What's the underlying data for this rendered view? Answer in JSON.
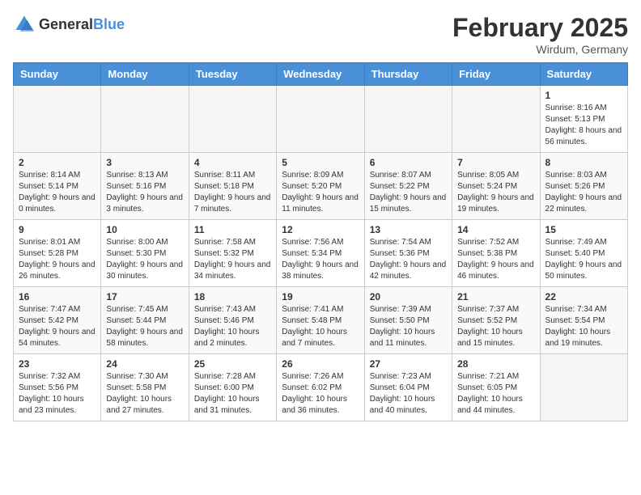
{
  "logo": {
    "general": "General",
    "blue": "Blue"
  },
  "header": {
    "month_year": "February 2025",
    "location": "Wirdum, Germany"
  },
  "weekdays": [
    "Sunday",
    "Monday",
    "Tuesday",
    "Wednesday",
    "Thursday",
    "Friday",
    "Saturday"
  ],
  "weeks": [
    [
      {
        "day": "",
        "detail": ""
      },
      {
        "day": "",
        "detail": ""
      },
      {
        "day": "",
        "detail": ""
      },
      {
        "day": "",
        "detail": ""
      },
      {
        "day": "",
        "detail": ""
      },
      {
        "day": "",
        "detail": ""
      },
      {
        "day": "1",
        "detail": "Sunrise: 8:16 AM\nSunset: 5:13 PM\nDaylight: 8 hours and 56 minutes."
      }
    ],
    [
      {
        "day": "2",
        "detail": "Sunrise: 8:14 AM\nSunset: 5:14 PM\nDaylight: 9 hours and 0 minutes."
      },
      {
        "day": "3",
        "detail": "Sunrise: 8:13 AM\nSunset: 5:16 PM\nDaylight: 9 hours and 3 minutes."
      },
      {
        "day": "4",
        "detail": "Sunrise: 8:11 AM\nSunset: 5:18 PM\nDaylight: 9 hours and 7 minutes."
      },
      {
        "day": "5",
        "detail": "Sunrise: 8:09 AM\nSunset: 5:20 PM\nDaylight: 9 hours and 11 minutes."
      },
      {
        "day": "6",
        "detail": "Sunrise: 8:07 AM\nSunset: 5:22 PM\nDaylight: 9 hours and 15 minutes."
      },
      {
        "day": "7",
        "detail": "Sunrise: 8:05 AM\nSunset: 5:24 PM\nDaylight: 9 hours and 19 minutes."
      },
      {
        "day": "8",
        "detail": "Sunrise: 8:03 AM\nSunset: 5:26 PM\nDaylight: 9 hours and 22 minutes."
      }
    ],
    [
      {
        "day": "9",
        "detail": "Sunrise: 8:01 AM\nSunset: 5:28 PM\nDaylight: 9 hours and 26 minutes."
      },
      {
        "day": "10",
        "detail": "Sunrise: 8:00 AM\nSunset: 5:30 PM\nDaylight: 9 hours and 30 minutes."
      },
      {
        "day": "11",
        "detail": "Sunrise: 7:58 AM\nSunset: 5:32 PM\nDaylight: 9 hours and 34 minutes."
      },
      {
        "day": "12",
        "detail": "Sunrise: 7:56 AM\nSunset: 5:34 PM\nDaylight: 9 hours and 38 minutes."
      },
      {
        "day": "13",
        "detail": "Sunrise: 7:54 AM\nSunset: 5:36 PM\nDaylight: 9 hours and 42 minutes."
      },
      {
        "day": "14",
        "detail": "Sunrise: 7:52 AM\nSunset: 5:38 PM\nDaylight: 9 hours and 46 minutes."
      },
      {
        "day": "15",
        "detail": "Sunrise: 7:49 AM\nSunset: 5:40 PM\nDaylight: 9 hours and 50 minutes."
      }
    ],
    [
      {
        "day": "16",
        "detail": "Sunrise: 7:47 AM\nSunset: 5:42 PM\nDaylight: 9 hours and 54 minutes."
      },
      {
        "day": "17",
        "detail": "Sunrise: 7:45 AM\nSunset: 5:44 PM\nDaylight: 9 hours and 58 minutes."
      },
      {
        "day": "18",
        "detail": "Sunrise: 7:43 AM\nSunset: 5:46 PM\nDaylight: 10 hours and 2 minutes."
      },
      {
        "day": "19",
        "detail": "Sunrise: 7:41 AM\nSunset: 5:48 PM\nDaylight: 10 hours and 7 minutes."
      },
      {
        "day": "20",
        "detail": "Sunrise: 7:39 AM\nSunset: 5:50 PM\nDaylight: 10 hours and 11 minutes."
      },
      {
        "day": "21",
        "detail": "Sunrise: 7:37 AM\nSunset: 5:52 PM\nDaylight: 10 hours and 15 minutes."
      },
      {
        "day": "22",
        "detail": "Sunrise: 7:34 AM\nSunset: 5:54 PM\nDaylight: 10 hours and 19 minutes."
      }
    ],
    [
      {
        "day": "23",
        "detail": "Sunrise: 7:32 AM\nSunset: 5:56 PM\nDaylight: 10 hours and 23 minutes."
      },
      {
        "day": "24",
        "detail": "Sunrise: 7:30 AM\nSunset: 5:58 PM\nDaylight: 10 hours and 27 minutes."
      },
      {
        "day": "25",
        "detail": "Sunrise: 7:28 AM\nSunset: 6:00 PM\nDaylight: 10 hours and 31 minutes."
      },
      {
        "day": "26",
        "detail": "Sunrise: 7:26 AM\nSunset: 6:02 PM\nDaylight: 10 hours and 36 minutes."
      },
      {
        "day": "27",
        "detail": "Sunrise: 7:23 AM\nSunset: 6:04 PM\nDaylight: 10 hours and 40 minutes."
      },
      {
        "day": "28",
        "detail": "Sunrise: 7:21 AM\nSunset: 6:05 PM\nDaylight: 10 hours and 44 minutes."
      },
      {
        "day": "",
        "detail": ""
      }
    ]
  ]
}
